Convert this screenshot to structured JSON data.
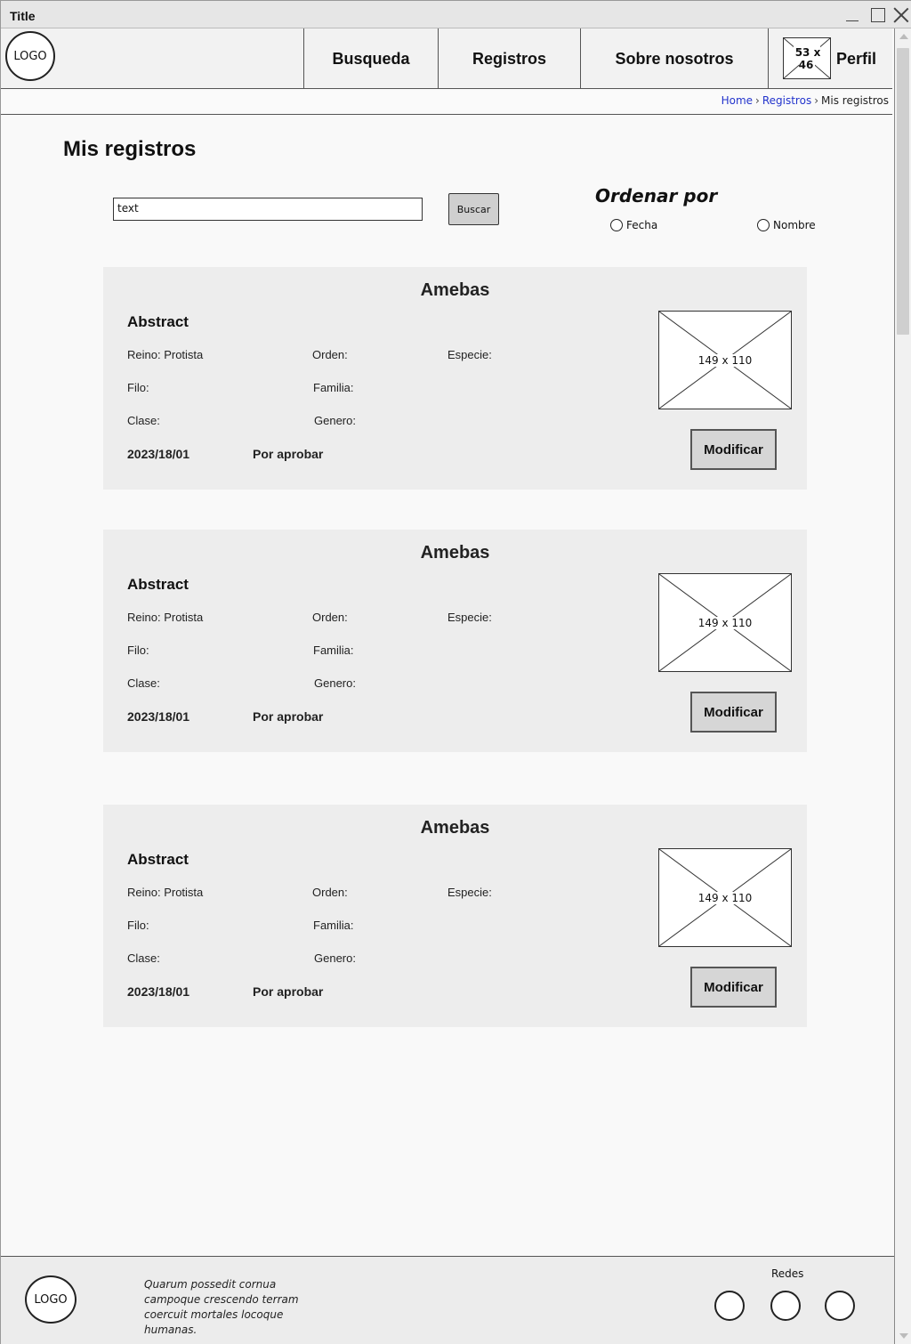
{
  "window": {
    "title": "Title"
  },
  "header": {
    "logo": "LOGO",
    "nav": [
      "Busqueda",
      "Registros",
      "Sobre nosotros"
    ],
    "profile": {
      "avatar_placeholder": "53 x 46",
      "label": "Perfil"
    }
  },
  "breadcrumb": {
    "home": "Home",
    "registros": "Registros",
    "current": "Mis registros",
    "separator": "›"
  },
  "page": {
    "title": "Mis registros"
  },
  "search": {
    "value": "text",
    "button": "Buscar"
  },
  "sort": {
    "title": "Ordenar por",
    "options": [
      "Fecha",
      "Nombre"
    ]
  },
  "cards": [
    {
      "title": "Amebas",
      "abstract": "Abstract",
      "reino": "Reino: Protista",
      "orden": "Orden:",
      "especie": "Especie:",
      "filo": "Filo:",
      "familia": "Familia:",
      "clase": "Clase:",
      "genero": "Genero:",
      "date": "2023/18/01",
      "status": "Por aprobar",
      "image_placeholder": "149 x 110",
      "button": "Modificar"
    },
    {
      "title": "Amebas",
      "abstract": "Abstract",
      "reino": "Reino: Protista",
      "orden": "Orden:",
      "especie": "Especie:",
      "filo": "Filo:",
      "familia": "Familia:",
      "clase": "Clase:",
      "genero": "Genero:",
      "date": "2023/18/01",
      "status": "Por aprobar",
      "image_placeholder": "149 x 110",
      "button": "Modificar"
    },
    {
      "title": "Amebas",
      "abstract": "Abstract",
      "reino": "Reino: Protista",
      "orden": "Orden:",
      "especie": "Especie:",
      "filo": "Filo:",
      "familia": "Familia:",
      "clase": "Clase:",
      "genero": "Genero:",
      "date": "2023/18/01",
      "status": "Por aprobar",
      "image_placeholder": "149 x 110",
      "button": "Modificar"
    }
  ],
  "footer": {
    "logo": "LOGO",
    "text": "Quarum possedit cornua campoque crescendo terram coercuit mortales locoque humanas.",
    "redes_label": "Redes"
  }
}
